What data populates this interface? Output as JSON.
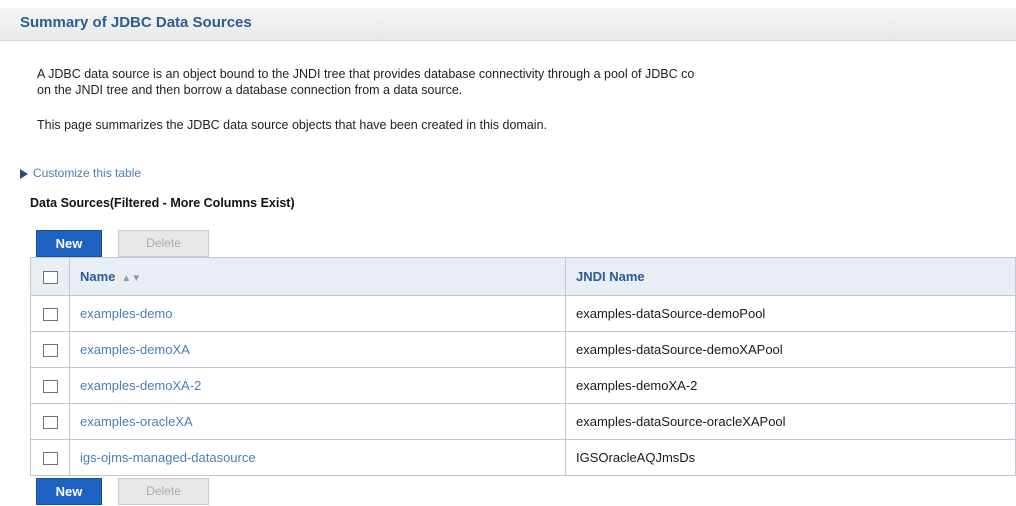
{
  "page_title": "Summary of JDBC Data Sources",
  "description_line1": "A JDBC data source is an object bound to the JNDI tree that provides database connectivity through a pool of JDBC co",
  "description_line2": "on the JNDI tree and then borrow a database connection from a data source.",
  "description_line3": "This page summarizes the JDBC data source objects that have been created in this domain.",
  "customize_link": "Customize this table",
  "section_title": "Data Sources(Filtered - More Columns Exist)",
  "buttons": {
    "new": "New",
    "delete": "Delete"
  },
  "table": {
    "columns": {
      "name": "Name",
      "jndi": "JNDI Name"
    },
    "rows": [
      {
        "name": "examples-demo",
        "jndi": "examples-dataSource-demoPool"
      },
      {
        "name": "examples-demoXA",
        "jndi": "examples-dataSource-demoXAPool"
      },
      {
        "name": "examples-demoXA-2",
        "jndi": "examples-demoXA-2"
      },
      {
        "name": "examples-oracleXA",
        "jndi": "examples-dataSource-oracleXAPool"
      },
      {
        "name": "igs-ojms-managed-datasource",
        "jndi": "IGSOracleAQJmsDs"
      }
    ]
  }
}
